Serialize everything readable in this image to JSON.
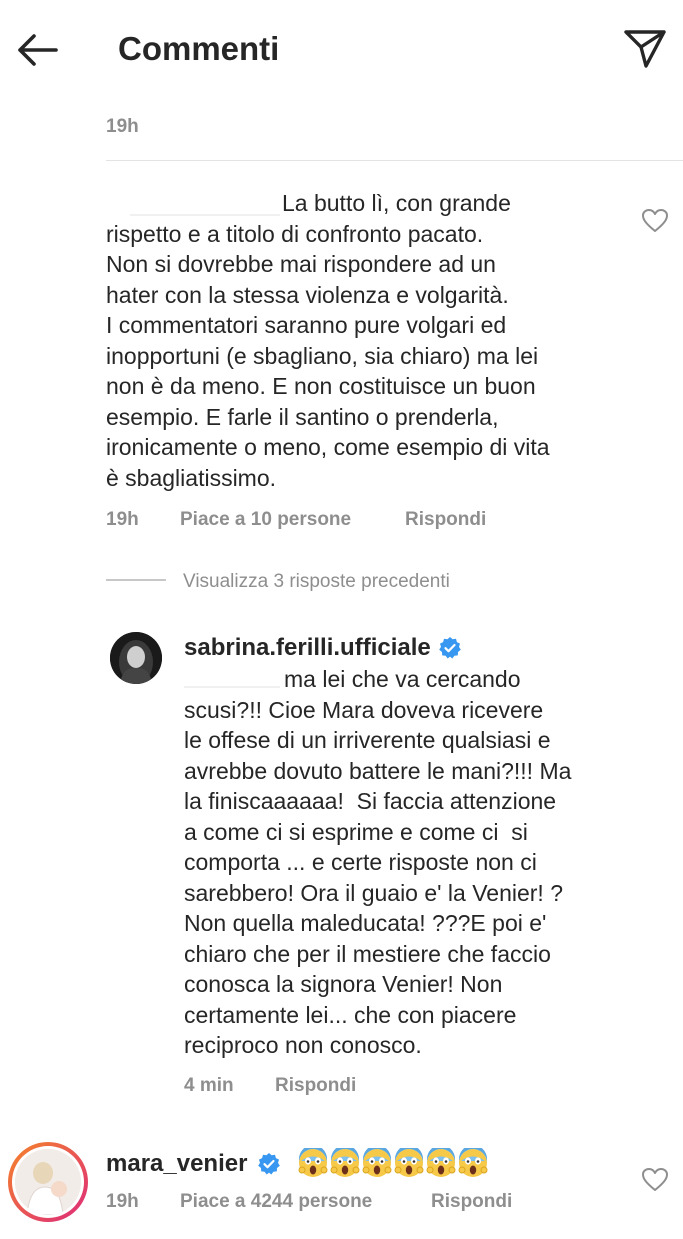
{
  "header": {
    "title": "Commenti",
    "back_icon": "arrow-left-icon",
    "send_icon": "paper-plane-icon"
  },
  "top_fragment": {
    "time": "19h"
  },
  "comment_1": {
    "text_first_line": "La butto lì, con grande",
    "text_rest": "rispetto e a titolo di confronto pacato.\nNon si dovrebbe mai rispondere ad un\nhater con la stessa violenza e volgarità.\nI commentatori saranno pure volgari ed\ninopportuni (e sbagliano, sia chiaro) ma lei\nnon è da meno. E non costituisce un buon\nesempio. E farle il santino o prenderla,\nironicamente o meno, come esempio di vita\nè sbagliatissimo.",
    "time": "19h",
    "likes": "Piace a 10 persone",
    "reply": "Rispondi"
  },
  "view_replies": {
    "label": "Visualizza 3 risposte precedenti"
  },
  "reply_sabrina": {
    "username": "sabrina.ferilli.ufficiale",
    "text_first_line": "ma lei che va cercando",
    "text_rest": "scusi?!! Cioe Mara doveva ricevere\nle offese di un irriverente qualsiasi e\navrebbe dovuto battere le mani?!!! Ma\nla finiscaaaaaa!  Si faccia attenzione\na come ci si esprime e come ci  si\ncomporta ... e certe risposte non ci\nsarebbero! Ora il guaio e' la Venier! ?\nNon quella maleducata! ???E poi e'\nchiaro che per il mestiere che faccio\nconosca la signora Venier! Non\ncertamente lei... che con piacere\nreciproco non conosco.",
    "time": "4 min",
    "reply": "Rispondi"
  },
  "comment_mara": {
    "username": "mara_venier",
    "emojis": [
      "😱",
      "😱",
      "😱",
      "😱",
      "😱",
      "😱"
    ],
    "time": "19h",
    "likes": "Piace a 4244 persone",
    "reply": "Rispondi"
  },
  "colors": {
    "text": "#262626",
    "secondary": "#8e8e8e",
    "verified": "#3897f0",
    "story_ring_start": "#f58529",
    "story_ring_end": "#dd2a7b"
  }
}
